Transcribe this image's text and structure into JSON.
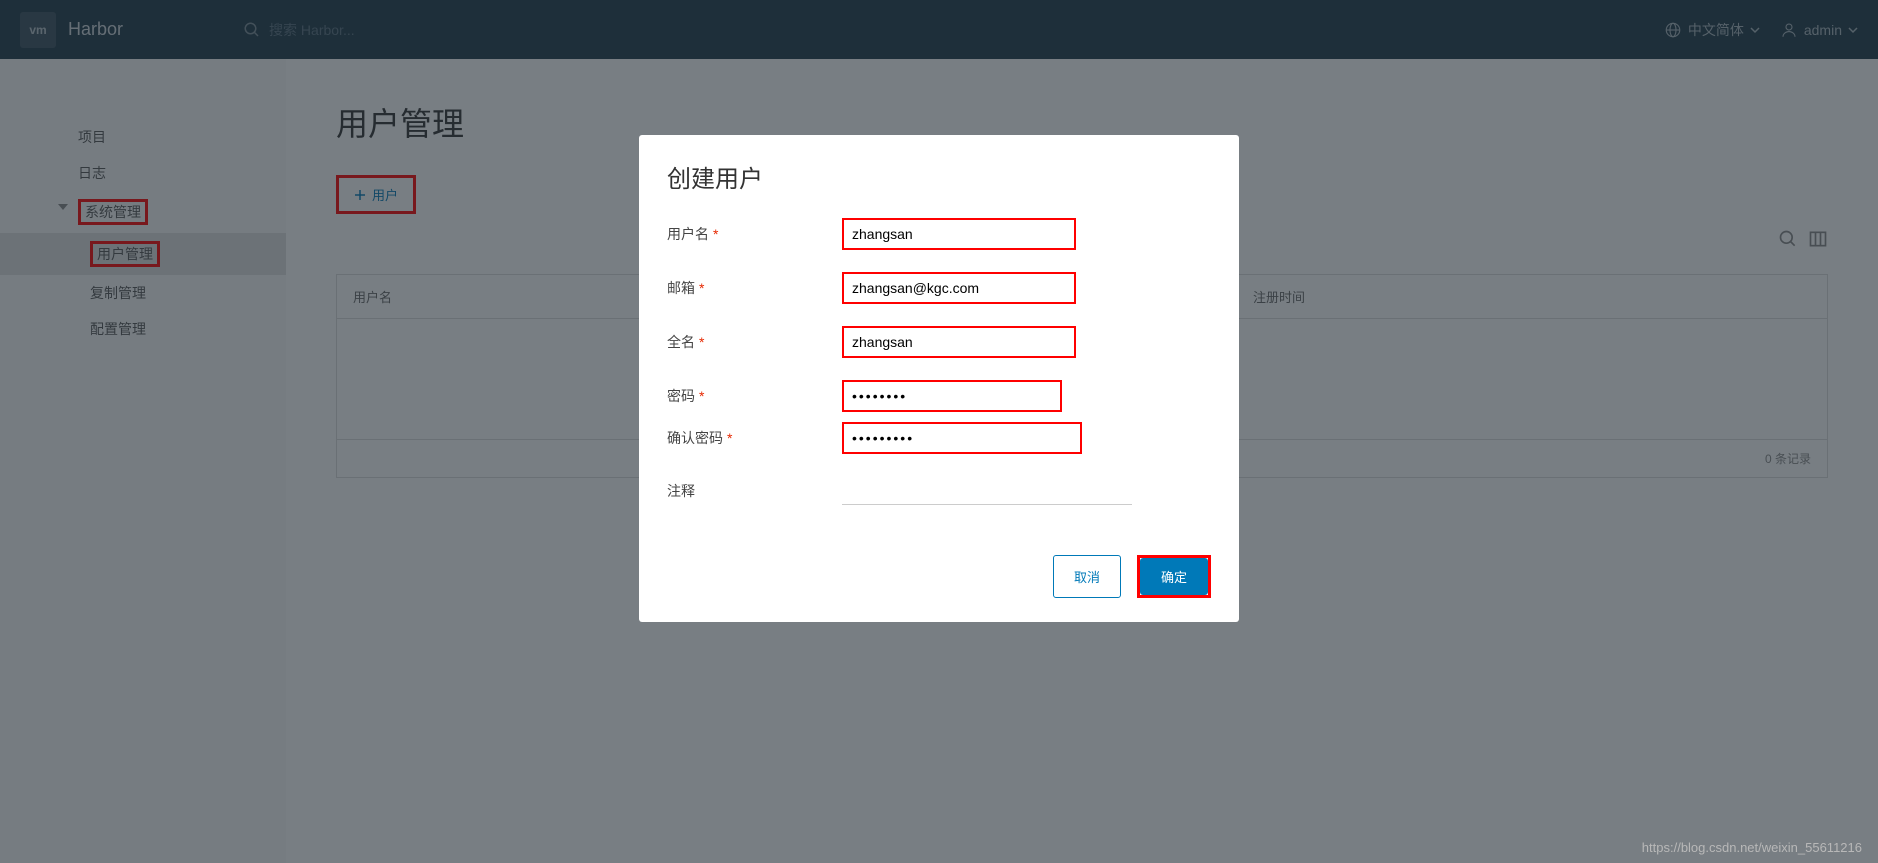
{
  "header": {
    "logo_text": "vm",
    "app_name": "Harbor",
    "search_placeholder": "搜索 Harbor...",
    "language_label": "中文简体",
    "user_label": "admin"
  },
  "sidebar": {
    "items": [
      {
        "label": "项目"
      },
      {
        "label": "日志"
      },
      {
        "label": "系统管理"
      },
      {
        "label": "用户管理"
      },
      {
        "label": "复制管理"
      },
      {
        "label": "配置管理"
      }
    ]
  },
  "main": {
    "title": "用户管理",
    "add_button_label": "用户",
    "table_headers": {
      "username": "用户名",
      "register_time": "注册时间"
    },
    "record_count": "0 条记录"
  },
  "modal": {
    "title": "创建用户",
    "fields": {
      "username": {
        "label": "用户名",
        "value": "zhangsan"
      },
      "email": {
        "label": "邮箱",
        "value": "zhangsan@kgc.com"
      },
      "fullname": {
        "label": "全名",
        "value": "zhangsan"
      },
      "password": {
        "label": "密码",
        "value": "••••••••"
      },
      "confirm_password": {
        "label": "确认密码",
        "value": "•••••••••"
      },
      "comment": {
        "label": "注释",
        "value": ""
      }
    },
    "cancel_label": "取消",
    "ok_label": "确定"
  },
  "watermark": "https://blog.csdn.net/weixin_55611216"
}
